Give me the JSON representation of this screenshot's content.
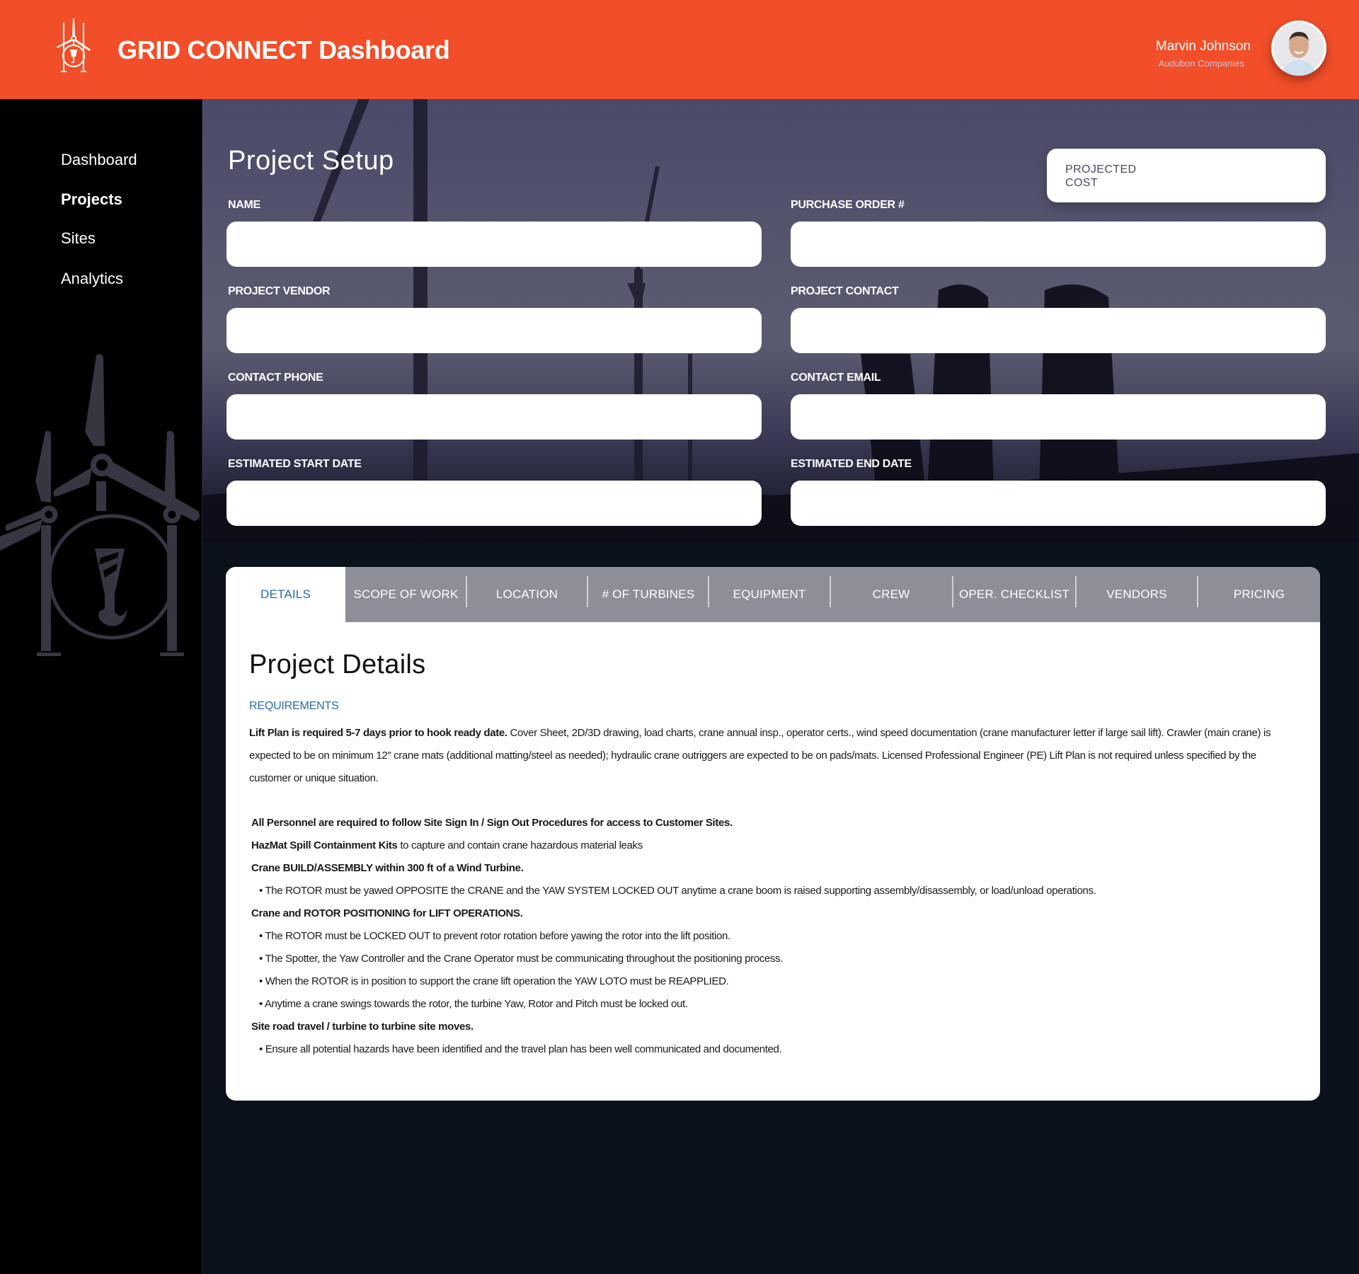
{
  "header": {
    "title": "GRID CONNECT Dashboard",
    "logo_icon": "wind-turbine-crane-hook-logo",
    "brand_color": "#f24e29",
    "user": {
      "name": "Marvin Johnson",
      "organization": "Audubon Companies",
      "avatar_icon": "user-avatar-photo"
    }
  },
  "sidebar": {
    "items": [
      {
        "label": "Dashboard",
        "active": false
      },
      {
        "label": "Projects",
        "active": true
      },
      {
        "label": "Sites",
        "active": false
      },
      {
        "label": "Analytics",
        "active": false
      }
    ],
    "illustration_icon": "wind-turbine-crane-hook-illustration"
  },
  "project_setup": {
    "title": "Project Setup",
    "projected_cost_label": "PROJECTED COST",
    "fields": [
      {
        "label": "NAME",
        "value": ""
      },
      {
        "label": "PURCHASE ORDER #",
        "value": ""
      },
      {
        "label": "PROJECT VENDOR",
        "value": ""
      },
      {
        "label": "PROJECT CONTACT",
        "value": ""
      },
      {
        "label": "CONTACT PHONE",
        "value": ""
      },
      {
        "label": "CONTACT EMAIL",
        "value": ""
      },
      {
        "label": "ESTIMATED START DATE",
        "value": ""
      },
      {
        "label": "ESTIMATED END DATE",
        "value": ""
      }
    ]
  },
  "tabs": [
    {
      "label": "DETAILS",
      "active": true
    },
    {
      "label": "SCOPE OF WORK",
      "active": false
    },
    {
      "label": "LOCATION",
      "active": false
    },
    {
      "label": "# OF TURBINES",
      "active": false
    },
    {
      "label": "EQUIPMENT",
      "active": false
    },
    {
      "label": "CREW",
      "active": false
    },
    {
      "label": "OPER. CHECKLIST",
      "active": false
    },
    {
      "label": "VENDORS",
      "active": false
    },
    {
      "label": "PRICING",
      "active": false
    }
  ],
  "details": {
    "title": "Project Details",
    "section_label": "REQUIREMENTS",
    "accent_color": "#2a6aa8",
    "intro_bold": "Lift Plan is required 5-7 days prior to hook ready date.",
    "intro_text": " Cover Sheet, 2D/3D drawing, load charts, crane annual insp., operator certs., wind speed documentation (crane manufacturer letter if large sail lift). Crawler (main crane) is expected to be on minimum 12″ crane mats (additional matting/steel as needed); hydraulic crane outriggers are expected to be on pads/mats. Licensed Professional Engineer (PE) Lift Plan is not required unless specified by the customer or unique situation.",
    "lines": [
      {
        "bold": "All  Personnel are required to follow Site Sign In / Sign Out Procedures for access to Customer Sites.",
        "text": ""
      },
      {
        "bold": "HazMat Spill Containment Kits",
        "text": " to capture and contain crane hazardous material leaks"
      },
      {
        "bold": "Crane BUILD/ASSEMBLY within 300 ft of a Wind Turbine.",
        "text": ""
      },
      {
        "bullet": "• The ROTOR must be yawed OPPOSITE the CRANE and the YAW SYSTEM LOCKED OUT anytime a crane boom is raised supporting assembly/disassembly, or load/unload operations."
      },
      {
        "bold": "Crane and ROTOR POSITIONING for LIFT OPERATIONS.",
        "text": ""
      },
      {
        "bullet": "• The ROTOR must be LOCKED OUT to prevent rotor rotation before yawing the rotor into the lift position."
      },
      {
        "bullet": "• The Spotter, the Yaw Controller and the Crane Operator must be communicating throughout the positioning process."
      },
      {
        "bullet": "• When the ROTOR is in position to support the crane lift operation the YAW LOTO must be REAPPLIED."
      },
      {
        "bullet": "• Anytime a crane swings towards the rotor, the turbine Yaw, Rotor and Pitch must be locked out."
      },
      {
        "bold": "Site road travel / turbine to turbine site moves.",
        "text": ""
      },
      {
        "bullet": "• Ensure all potential hazards have been identified and the travel plan has been well communicated and documented."
      }
    ]
  }
}
